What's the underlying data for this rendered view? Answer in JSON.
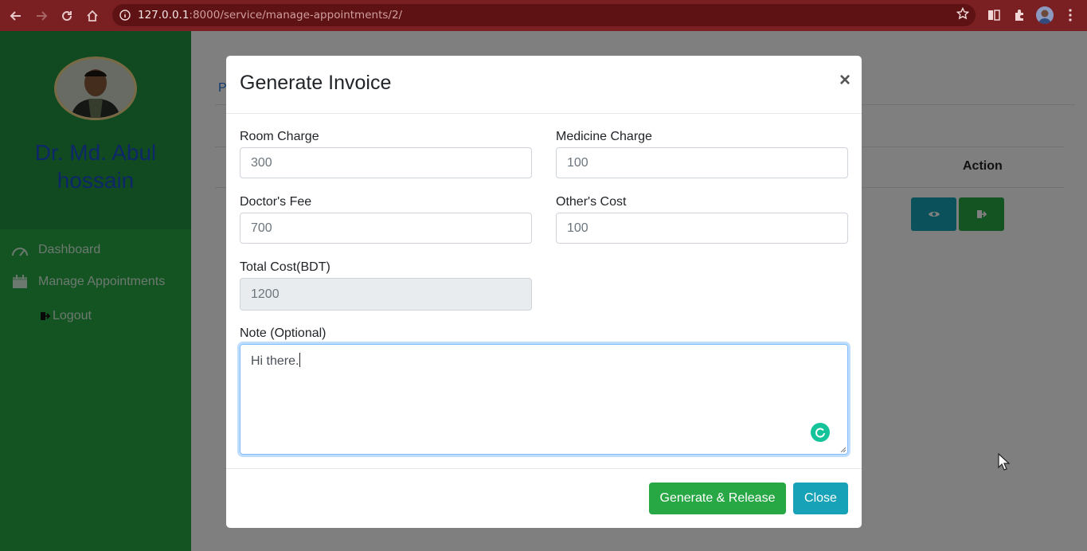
{
  "browser": {
    "url_host": "127.0.0.1",
    "url_rest": ":8000/service/manage-appointments/2/",
    "colors": {
      "toolbar": "#7a1f22",
      "omnibox": "#5e1214"
    }
  },
  "sidebar": {
    "doctor_name": "Dr. Md. Abul hossain",
    "items": [
      {
        "label": "Dashboard",
        "icon": "speedometer-icon"
      },
      {
        "label": "Manage Appointments",
        "icon": "calendar-icon"
      },
      {
        "label": "Logout",
        "icon": "logout-icon"
      }
    ],
    "colors": {
      "background": "#28a745",
      "name": "#1a4fd0"
    }
  },
  "page": {
    "tab_fragment": "P",
    "table": {
      "action_header": "Action"
    }
  },
  "modal": {
    "title": "Generate Invoice",
    "close_symbol": "×",
    "fields": {
      "room_charge": {
        "label": "Room Charge",
        "value": "300"
      },
      "medicine_charge": {
        "label": "Medicine Charge",
        "value": "100"
      },
      "doctors_fee": {
        "label": "Doctor's Fee",
        "value": "700"
      },
      "others_cost": {
        "label": "Other's Cost",
        "value": "100"
      },
      "total_cost": {
        "label": "Total Cost(BDT)",
        "value": "1200"
      },
      "note": {
        "label": "Note (Optional)",
        "value": "Hi there."
      }
    },
    "buttons": {
      "generate": "Generate & Release",
      "close": "Close"
    },
    "colors": {
      "generate": "#28a745",
      "close": "#17a2b8"
    }
  }
}
